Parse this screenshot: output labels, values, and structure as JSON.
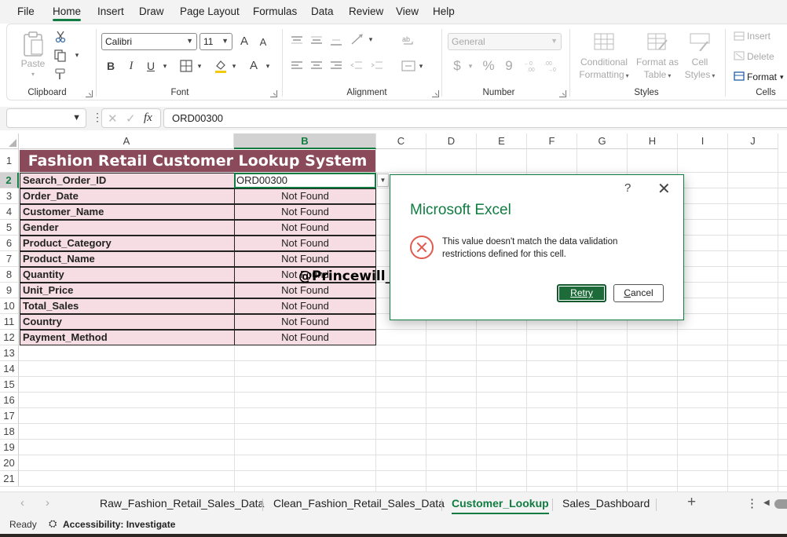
{
  "menu": [
    "File",
    "Home",
    "Insert",
    "Draw",
    "Page Layout",
    "Formulas",
    "Data",
    "Review",
    "View",
    "Help"
  ],
  "ribbon": {
    "clipboard": {
      "paste": "Paste",
      "label": "Clipboard"
    },
    "font": {
      "name": "Calibri",
      "size": "11",
      "bold": "B",
      "italic": "I",
      "underline": "U",
      "grow": "A",
      "shrink": "A",
      "color": "A",
      "label": "Font"
    },
    "alignment": {
      "label": "Alignment"
    },
    "number": {
      "format": "General",
      "currency": "$",
      "percent": "%",
      "comma": "9",
      "label": "Number"
    },
    "styles": {
      "conditional": [
        "Conditional",
        "Formatting"
      ],
      "format_table": [
        "Format as",
        "Table"
      ],
      "cell_styles": [
        "Cell",
        "Styles"
      ],
      "label": "Styles"
    },
    "cells": {
      "insert": "Insert",
      "delete": "Delete",
      "format": "Format",
      "label": "Cells"
    }
  },
  "formula_bar": {
    "name_box": "",
    "fx": "fx",
    "value": "ORD00300"
  },
  "columns": [
    "A",
    "B",
    "C",
    "D",
    "E",
    "F",
    "G",
    "H",
    "I",
    "J"
  ],
  "rows": [
    "1",
    "2",
    "3",
    "4",
    "5",
    "6",
    "7",
    "8",
    "9",
    "10",
    "11",
    "12",
    "13",
    "14",
    "15",
    "16",
    "17",
    "18",
    "19",
    "20",
    "21"
  ],
  "sheet": {
    "title": "Fashion Retail Customer Lookup System",
    "search_label": "Search_Order_ID",
    "search_value": "ORD00300",
    "fields": [
      {
        "label": "Order_Date",
        "value": "Not Found"
      },
      {
        "label": "Customer_Name",
        "value": "Not Found"
      },
      {
        "label": "Gender",
        "value": "Not Found"
      },
      {
        "label": "Product_Category",
        "value": "Not Found"
      },
      {
        "label": "Product_Name",
        "value": "Not Found"
      },
      {
        "label": "Quantity",
        "value": "Not Found"
      },
      {
        "label": "Unit_Price",
        "value": "Not Found"
      },
      {
        "label": "Total_Sales",
        "value": "Not Found"
      },
      {
        "label": "Country",
        "value": "Not Found"
      },
      {
        "label": "Payment_Method",
        "value": "Not Found"
      }
    ]
  },
  "watermark": "@Princewill_Data",
  "dialog": {
    "help": "?",
    "close": "✕",
    "title": "Microsoft Excel",
    "message": "This value doesn't match the data validation restrictions defined for this cell.",
    "retry": "Retry",
    "cancel_first": "C",
    "cancel_rest": "ancel"
  },
  "tabs": [
    "Raw_Fashion_Retail_Sales_Data",
    "Clean_Fashion_Retail_Sales_Data",
    "Customer_Lookup",
    "Sales_Dashboard"
  ],
  "status": {
    "ready": "Ready",
    "accessibility": "Accessibility: Investigate"
  },
  "colors": {
    "accent": "#107c41",
    "title_fill": "#8b4a5a",
    "cell_fill": "#f6dde3",
    "error": "#e05a4f"
  }
}
